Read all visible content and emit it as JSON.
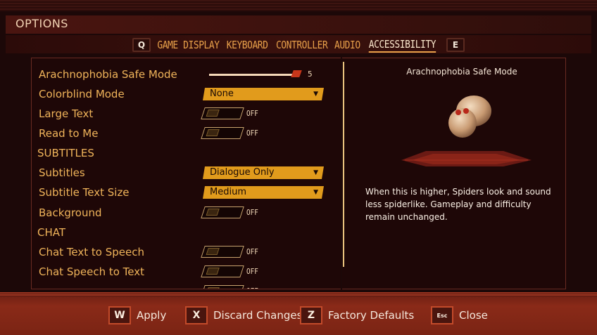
{
  "window": {
    "title": "OPTIONS"
  },
  "tabs": {
    "prev_key": "Q",
    "next_key": "E",
    "items": [
      {
        "label": "GAME",
        "active": false
      },
      {
        "label": "DISPLAY",
        "active": false
      },
      {
        "label": "KEYBOARD",
        "active": false
      },
      {
        "label": "CONTROLLER",
        "active": false
      },
      {
        "label": "AUDIO",
        "active": false
      },
      {
        "label": "ACCESSIBILITY",
        "active": true
      }
    ]
  },
  "settings": {
    "arachnophobia": {
      "label": "Arachnophobia Safe Mode",
      "value": "5",
      "level": 5
    },
    "colorblind": {
      "label": "Colorblind Mode",
      "value": "None"
    },
    "large_text": {
      "label": "Large Text",
      "value": "OFF"
    },
    "read_to_me": {
      "label": "Read to Me",
      "value": "OFF"
    },
    "subtitles_section": "SUBTITLES",
    "subtitles": {
      "label": "Subtitles",
      "value": "Dialogue Only"
    },
    "subtitle_size": {
      "label": "Subtitle Text Size",
      "value": "Medium"
    },
    "background": {
      "label": "Background",
      "value": "OFF"
    },
    "chat_section": "CHAT",
    "chat_tts": {
      "label": "Chat Text to Speech",
      "value": "OFF"
    },
    "chat_stt": {
      "label": "Chat Speech to Text",
      "value": "OFF"
    },
    "partial_row": {
      "value": "OFF"
    }
  },
  "info_panel": {
    "title": "Arachnophobia Safe Mode",
    "description": "When this is higher, Spiders look and sound less spiderlike. Gameplay and difficulty remain unchanged."
  },
  "footer": {
    "apply": {
      "key": "W",
      "label": "Apply"
    },
    "discard": {
      "key": "X",
      "label": "Discard Changes"
    },
    "defaults": {
      "key": "Z",
      "label": "Factory Defaults"
    },
    "close": {
      "key": "Esc",
      "label": "Close"
    }
  },
  "colors": {
    "accent": "#f0b45a",
    "dropdown": "#e19b1c",
    "footer": "#8a2a18"
  }
}
